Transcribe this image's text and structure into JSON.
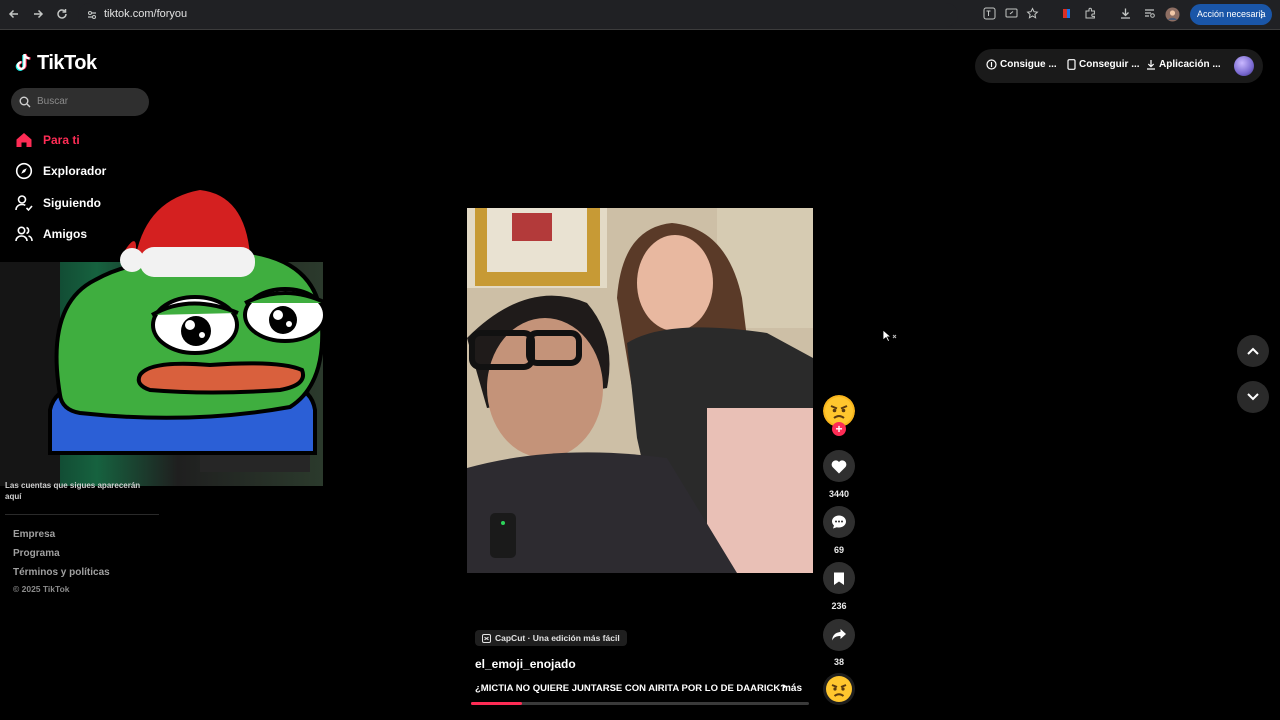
{
  "browser": {
    "url": "tiktok.com/foryou",
    "action_label": "Acción necesaria",
    "icons": [
      "back-icon",
      "forward-icon",
      "reload-icon",
      "site-info-icon",
      "translate-icon",
      "screen-share-icon",
      "bookmark-star-icon",
      "extension-icon",
      "puzzle-icon",
      "download-icon",
      "tab-search-icon",
      "profile-icon",
      "menu-icon"
    ]
  },
  "app": {
    "logo_text": "TikTok",
    "search_placeholder": "Buscar"
  },
  "sidebar": {
    "items": [
      {
        "label": "Para ti",
        "icon": "home-icon",
        "active": true
      },
      {
        "label": "Explorador",
        "icon": "compass-icon",
        "active": false
      },
      {
        "label": "Siguiendo",
        "icon": "following-icon",
        "active": false
      },
      {
        "label": "Amigos",
        "icon": "friends-icon",
        "active": false
      }
    ],
    "note": "Las cuentas que sigues aparecerán aquí",
    "footer": [
      "Empresa",
      "Programa",
      "Términos y políticas"
    ],
    "copyright": "© 2025 TikTok"
  },
  "topbar": {
    "coins_label": "Consigue ...",
    "get_label": "Conseguir ...",
    "app_label": "Aplicación ..."
  },
  "video": {
    "badge": "CapCut · Una edición más fácil",
    "username": "el_emoji_enojado",
    "description": "¿MICTIA NO QUIERE JUNTARSE CON AIRITA POR LO DE DAARICK?",
    "more_label": "más",
    "progress": 0.15
  },
  "actions": {
    "likes": "3440",
    "comments": "69",
    "saves": "236",
    "shares": "38"
  },
  "colors": {
    "accent": "#fe2c55",
    "background": "#000000",
    "button_bg": "#2f2f2f"
  }
}
